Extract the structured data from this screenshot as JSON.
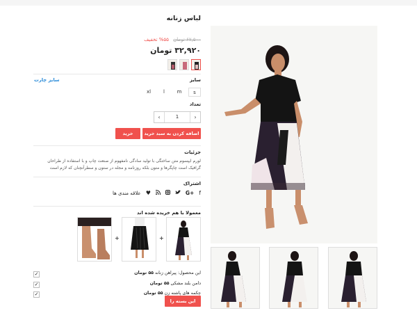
{
  "product": {
    "title": "لباس زنانه",
    "old_price": "۶۷,۵۰۰ تومان",
    "discount": "۵۵% تخفیف",
    "price": "۳۲,۹۲۰ تومان"
  },
  "colors": [
    "pink-black",
    "pink-plaid",
    "black-floral"
  ],
  "size": {
    "label": "سایز",
    "chart_link": "سایز چارت",
    "options": [
      "s",
      "m",
      "l",
      "xl"
    ],
    "selected": "s"
  },
  "quantity": {
    "label": "تعداد",
    "value": "1",
    "plus": "+",
    "minus": "−"
  },
  "buttons": {
    "add_to_cart": "اضافه کردن به سبد خرید",
    "buy": "خرید",
    "bundle": "این بسته را بخرید"
  },
  "details": {
    "label": "جزئیات",
    "text": "لورم ایپسوم متن ساختگی با تولید سادگی نامفهوم از صنعت چاپ و با استفاده از طراحان گرافیک است چاپگرها و متون بلکه روزنامه و مجله در ستون و سطرآنچنان که لازم است"
  },
  "share": {
    "label": "اشتراک",
    "favorites": "علاقه مندی ها",
    "icons": [
      "facebook-icon",
      "google-plus-icon",
      "twitter-icon",
      "instagram-icon",
      "rss-icon"
    ]
  },
  "bundle": {
    "label": "معمولا با هم خریده شده اند",
    "items": [
      {
        "name": "این محصول: پیراهن زنانه",
        "price": "۵۵ تومان"
      },
      {
        "name": "دامن بلند مشکی",
        "price": "۵۵ تومان"
      },
      {
        "name": "چکمه های پاشنه زن",
        "price": "۵۵ تومان"
      }
    ]
  },
  "accent_color": "#f0514d",
  "link_color": "#2a8bd8"
}
